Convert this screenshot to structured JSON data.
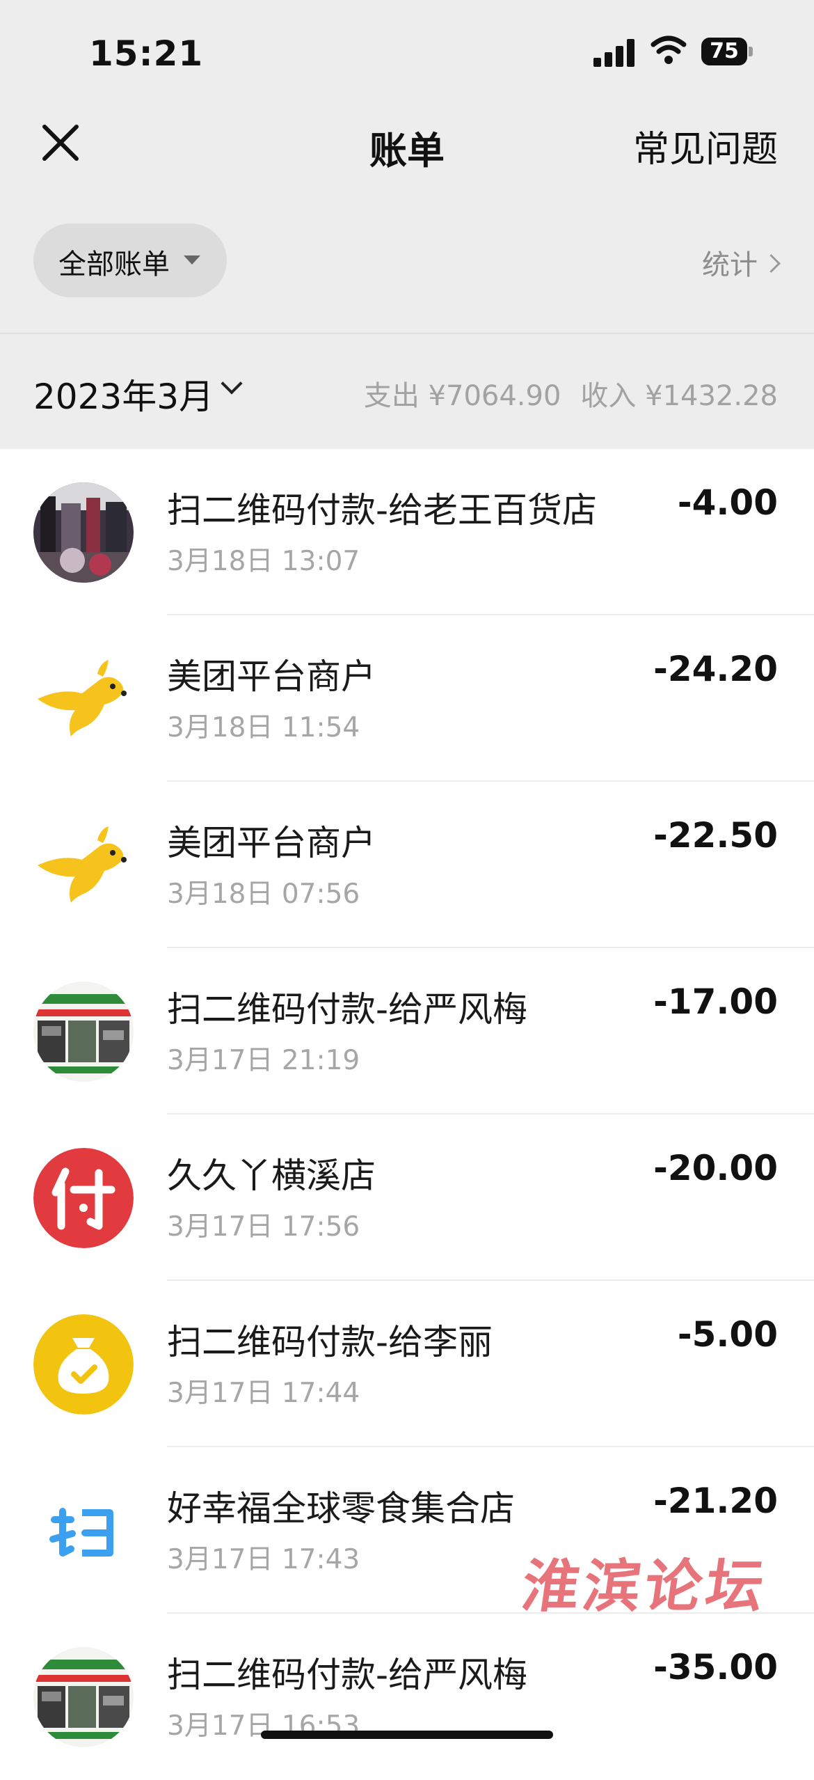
{
  "status_bar": {
    "time": "15:21",
    "battery": "75"
  },
  "nav": {
    "title": "账单",
    "right_link": "常见问题"
  },
  "filter": {
    "label": "全部账单",
    "stats_link": "统计"
  },
  "month": {
    "label": "2023年3月",
    "expense": "支出 ¥7064.90",
    "income": "收入 ¥1432.28"
  },
  "transactions": [
    {
      "title": "扫二维码付款-给老王百货店",
      "time": "3月18日 13:07",
      "amount": "-4.00",
      "icon": "store-photo-avatar"
    },
    {
      "title": "美团平台商户",
      "time": "3月18日 11:54",
      "amount": "-24.20",
      "icon": "meituan-kangaroo-icon"
    },
    {
      "title": "美团平台商户",
      "time": "3月18日 07:56",
      "amount": "-22.50",
      "icon": "meituan-kangaroo-icon"
    },
    {
      "title": "扫二维码付款-给严风梅",
      "time": "3月17日 21:19",
      "amount": "-17.00",
      "icon": "shop-sign-avatar"
    },
    {
      "title": "久久丫横溪店",
      "time": "3月17日 17:56",
      "amount": "-20.00",
      "icon": "pay-icon"
    },
    {
      "title": "扫二维码付款-给李丽",
      "time": "3月17日 17:44",
      "amount": "-5.00",
      "icon": "money-bag-icon"
    },
    {
      "title": "好幸福全球零食集合店",
      "time": "3月17日 17:43",
      "amount": "-21.20",
      "icon": "scan-icon"
    },
    {
      "title": "扫二维码付款-给严风梅",
      "time": "3月17日 16:53",
      "amount": "-35.00",
      "icon": "shop-sign-avatar"
    }
  ],
  "watermark": "淮滨论坛",
  "colors": {
    "header_bg": "#ededed",
    "pay_red": "#e23b3f",
    "bag_yellow": "#f2c40f",
    "meituan_yellow": "#f6c21c",
    "scan_blue": "#3aa0ef"
  }
}
